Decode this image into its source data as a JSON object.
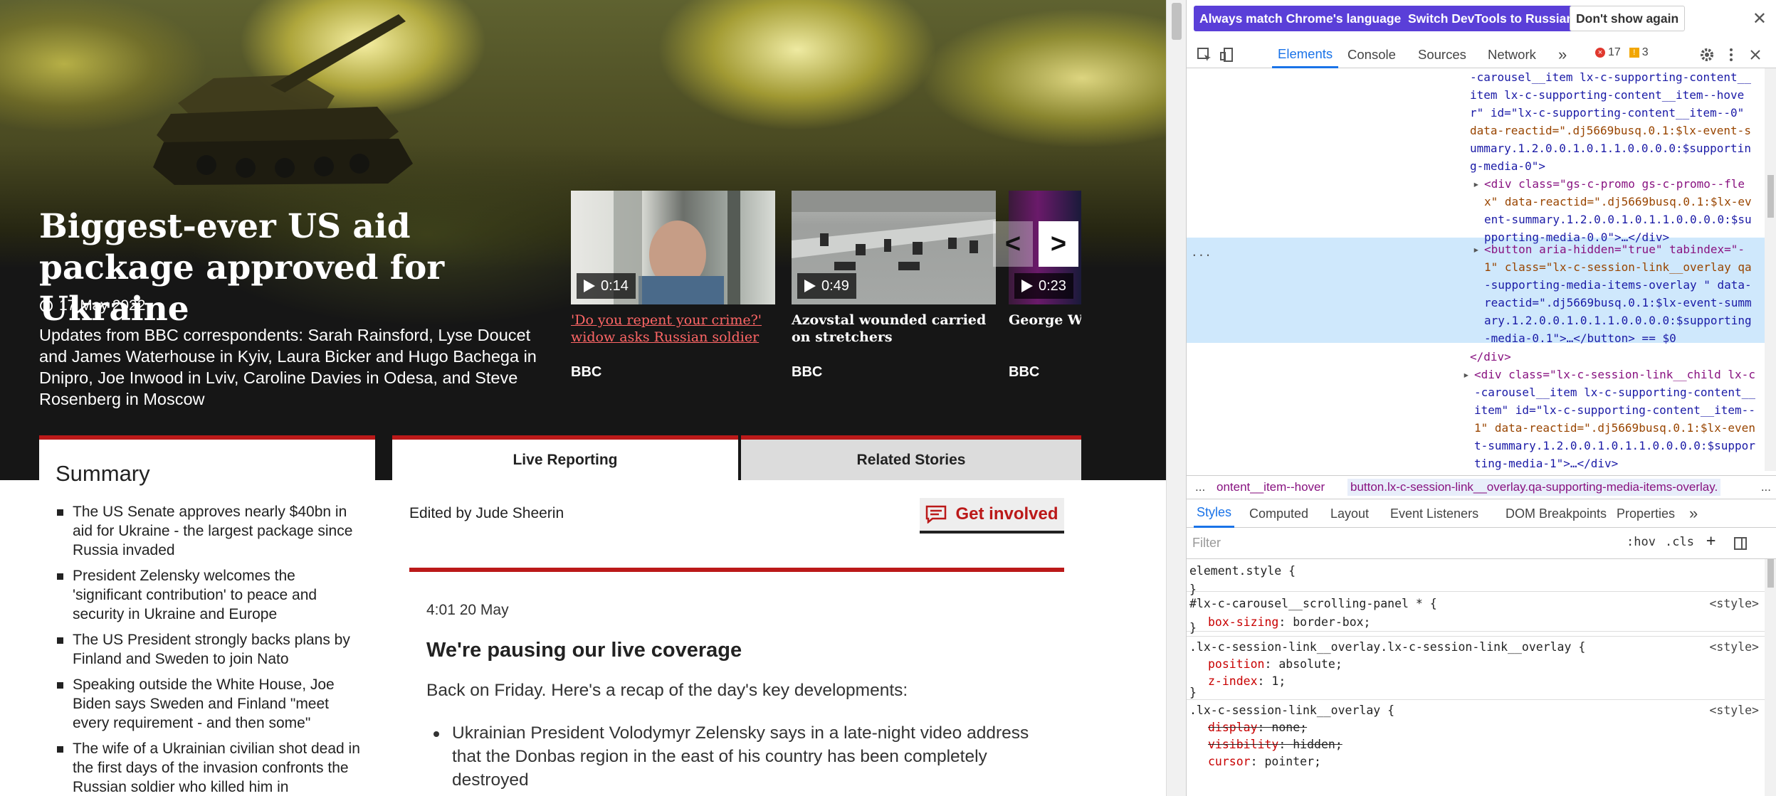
{
  "hero": {
    "title": "Biggest-ever US aid package approved for Ukraine",
    "date": "17 May 2022",
    "description": "Updates from BBC correspondents: Sarah Rainsford, Lyse Doucet and James Waterhouse in Kyiv, Laura Bicker and Hugo Bachega in Dnipro, Joe Inwood in Lviv, Caroline Davies in Odesa, and Steve Rosenberg in Moscow"
  },
  "carousel": {
    "prev_label": "<",
    "next_label": ">",
    "items": [
      {
        "duration": "0:14",
        "title": "'Do you repent your crime?' widow asks Russian soldier",
        "source": "BBC"
      },
      {
        "duration": "0:49",
        "title": "Azovstal wounded carried on stretchers",
        "source": "BBC"
      },
      {
        "duration": "0:23",
        "title": "George W B invasion of",
        "source": "BBC"
      }
    ]
  },
  "summary": {
    "heading": "Summary",
    "items": [
      "The US Senate approves nearly $40bn in aid for Ukraine - the largest package since Russia invaded",
      "President Zelensky welcomes the 'significant contribution' to peace and security in Ukraine and Europe",
      "The US President strongly backs plans by Finland and Sweden to join Nato",
      "Speaking outside the White House, Joe Biden says Sweden and Finland \"meet every requirement - and then some\"",
      "The wife of a Ukrainian civilian shot dead in the first days of the invasion confronts the Russian soldier who killed him in"
    ]
  },
  "tabs": {
    "live": "Live Reporting",
    "related": "Related Stories"
  },
  "feed": {
    "edited_by": "Edited by Jude Sheerin",
    "get_involved": "Get involved",
    "post": {
      "time": "4:01 20 May",
      "title": "We're pausing our live coverage",
      "body": "Back on Friday. Here's a recap of the day's key developments:",
      "bullets": [
        "Ukrainian President Volodymyr Zelensky says in a late-night video address that the Donbas region in the east of his country has been completely destroyed"
      ]
    }
  },
  "devtools": {
    "lang_bar": {
      "match": "Always match Chrome's language",
      "switch": "Switch DevTools to Russian",
      "dismiss": "Don't show again"
    },
    "tabs": [
      "Elements",
      "Console",
      "Sources",
      "Network"
    ],
    "more_tabs": "»",
    "errors": "17",
    "warnings": "3",
    "breadcrumbs": {
      "first": "ontent__item--hover",
      "second": "button.lx-c-session-link__overlay.qa-supporting-media-items-overlay.",
      "more": "..."
    },
    "subtabs": [
      "Styles",
      "Computed",
      "Layout",
      "Event Listeners",
      "DOM Breakpoints",
      "Properties"
    ],
    "filter_placeholder": "Filter",
    "hov": ":hov",
    "cls": ".cls",
    "add": "+",
    "dom_lines": [
      "-carousel__item lx-c-supporting-content__",
      "item lx-c-supporting-content__item--hove",
      "r\" id=\"lx-c-supporting-content__item--0\"",
      "data-reactid=\".dj5669busq.0.1:$lx-event-s",
      "ummary.1.2.0.0.1.0.1.1.0.0.0.0:$supportin",
      "g-media-0\">",
      "<div class=\"gs-c-promo gs-c-promo--fle",
      "x\" data-reactid=\".dj5669busq.0.1:$lx-ev",
      "ent-summary.1.2.0.0.1.0.1.1.0.0.0.0:$su",
      "pporting-media-0.0\">…</div>",
      "<button aria-hidden=\"true\" tabindex=\"-",
      "1\" class=\"lx-c-session-link__overlay qa",
      "-supporting-media-items-overlay \" data-",
      "reactid=\".dj5669busq.0.1:$lx-event-summ",
      "ary.1.2.0.0.1.0.1.1.0.0.0.0:$supporting",
      "-media-0.1\">…</button> == $0",
      "</div>",
      "<div class=\"lx-c-session-link__child lx-c",
      "-carousel__item lx-c-supporting-content__",
      "item\" id=\"lx-c-supporting-content__item--",
      "1\" data-reactid=\".dj5669busq.0.1:$lx-even",
      "t-summary.1.2.0.0.1.0.1.1.0.0.0.0:$suppor",
      "ting-media-1\">…</div>"
    ],
    "styles": {
      "element_style": "element.style {",
      "rules": [
        {
          "selector": "#lx-c-carousel__scrolling-panel * {",
          "source": "<style>",
          "props": [
            {
              "name": "box-sizing",
              "value": "border-box;"
            }
          ]
        },
        {
          "selector": ".lx-c-session-link__overlay.lx-c-session-link__overlay {",
          "source": "<style>",
          "props": [
            {
              "name": "position",
              "value": "absolute;"
            },
            {
              "name": "z-index",
              "value": "1;"
            }
          ]
        },
        {
          "selector": ".lx-c-session-link__overlay {",
          "source": "<style>",
          "props": [
            {
              "name": "display",
              "value": "none;"
            },
            {
              "name": "visibility",
              "value": "hidden;"
            },
            {
              "name": "cursor",
              "value": "pointer;"
            }
          ]
        }
      ]
    }
  }
}
